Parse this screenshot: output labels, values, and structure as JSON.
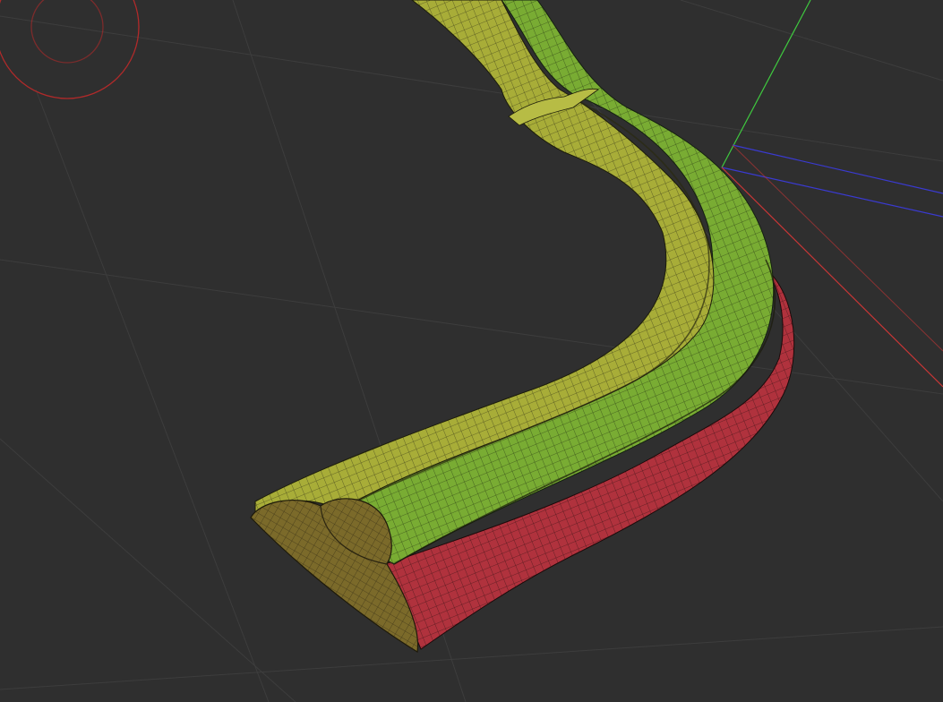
{
  "viewport": {
    "background": "#2f2f2f",
    "grid_color": "#3c3c3c",
    "gizmo_color": "#b12a2a"
  },
  "axes": {
    "x_color": "#c93636",
    "y_color": "#3fc93f",
    "z_color": "#3a3ad0"
  },
  "mesh": {
    "wireframe_color": "#1e1e10",
    "parts": [
      {
        "name": "yellow-part",
        "color": "#a8ad38",
        "shade": "#7f8428"
      },
      {
        "name": "green-part",
        "color": "#79ac33",
        "shade": "#57802a"
      },
      {
        "name": "red-part",
        "color": "#b0323d",
        "shade": "#7f1f28"
      },
      {
        "name": "end-cap",
        "color": "#7b6a2a",
        "shade": "#5b4e20"
      }
    ]
  }
}
